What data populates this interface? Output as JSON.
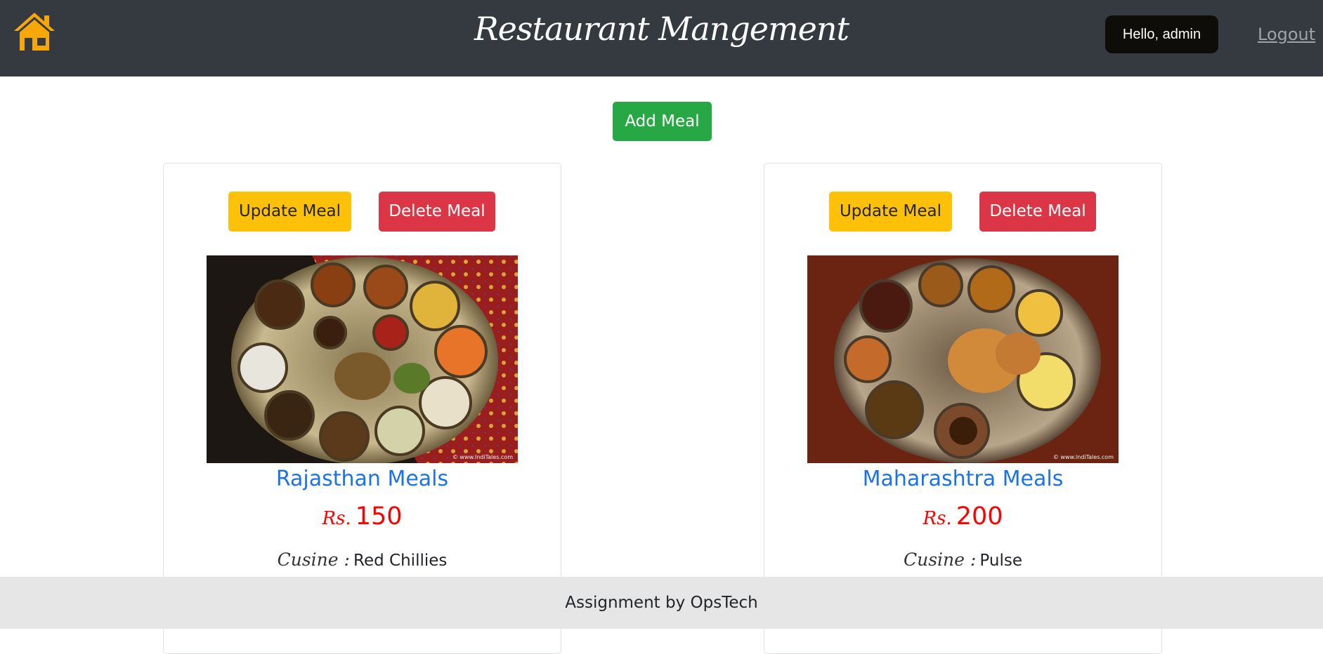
{
  "header": {
    "home_icon": "home-icon",
    "brand": "Restaurant Mangement",
    "greeting": "Hello, admin",
    "logout": "Logout"
  },
  "actions": {
    "add_meal": "Add Meal"
  },
  "colors": {
    "navbar": "#343a40",
    "home_icon": "#f7a707",
    "add_button": "#28a745",
    "update_button": "#ffc107",
    "delete_button": "#dc3545",
    "meal_name": "#1a73e8",
    "price": "#ff0000",
    "footer": "#e6e6e6"
  },
  "meals": [
    {
      "update_label": "Update Meal",
      "delete_label": "Delete Meal",
      "name": "Rajasthan Meals",
      "currency": "Rs.",
      "price": "150",
      "cuisine_label": "Cusine :",
      "cuisine": "Red Chillies",
      "watermark": "© www.IndiTales.com"
    },
    {
      "update_label": "Update Meal",
      "delete_label": "Delete Meal",
      "name": "Maharashtra Meals",
      "currency": "Rs.",
      "price": "200",
      "cuisine_label": "Cusine :",
      "cuisine": "Pulse",
      "watermark": "© www.IndiTales.com"
    }
  ],
  "footer": {
    "text": "Assignment by OpsTech"
  }
}
